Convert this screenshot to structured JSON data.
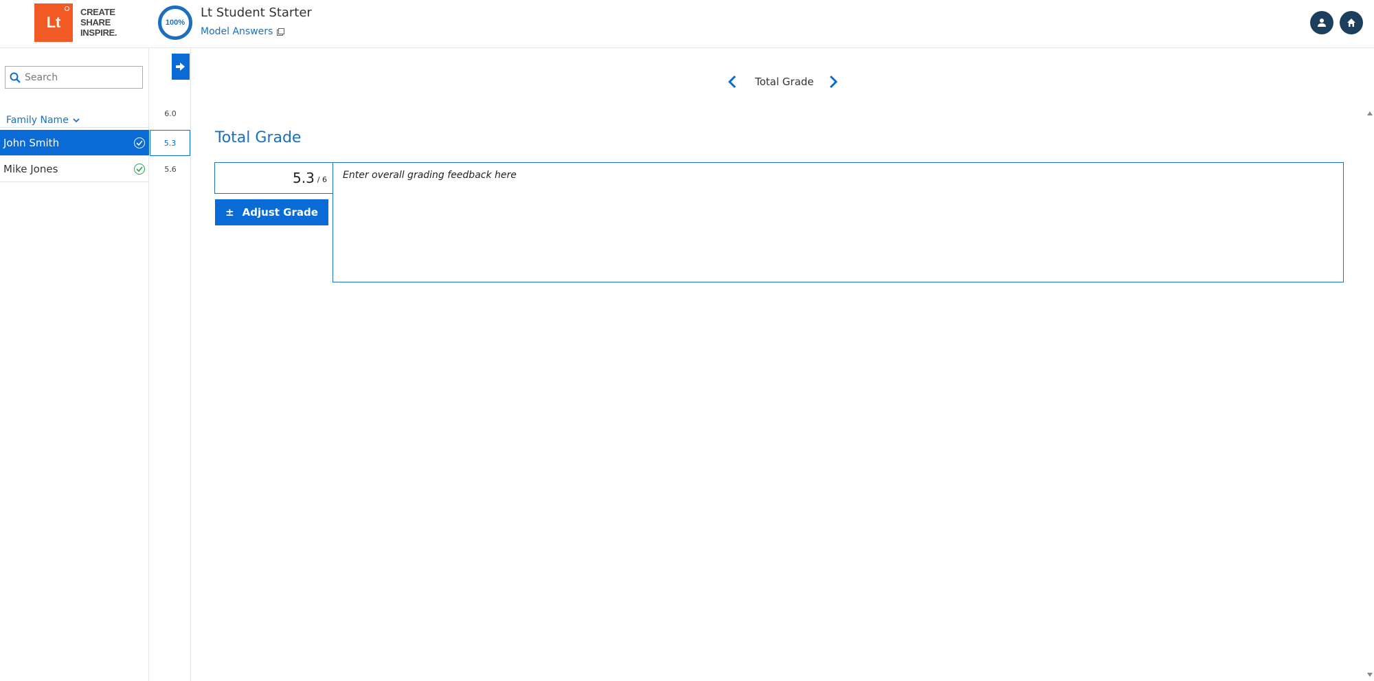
{
  "header": {
    "logo_text": "Lt",
    "logo_tagline": [
      "CREATE",
      "SHARE",
      "INSPIRE."
    ],
    "progress": "100%",
    "course_title": "Lt Student Starter",
    "model_answers_label": "Model Answers"
  },
  "sidebar": {
    "search_placeholder": "Search",
    "sort_label": "Family Name",
    "students": [
      {
        "name": "John Smith",
        "selected": true
      },
      {
        "name": "Mike Jones",
        "selected": false
      }
    ]
  },
  "scores": {
    "header": "6.0",
    "values": [
      "5.3",
      "5.6"
    ]
  },
  "main": {
    "nav_title": "Total Grade",
    "section_title": "Total Grade",
    "grade_value": "5.3",
    "grade_max": "/ 6",
    "adjust_icon": "±",
    "adjust_label": "Adjust Grade",
    "feedback_placeholder": "Enter overall grading feedback here"
  },
  "colors": {
    "accent": "#0a6ad6",
    "link": "#1a6fbf",
    "logo": "#f15a24",
    "dark_button": "#1c3f5e",
    "check": "#2aa34a"
  }
}
